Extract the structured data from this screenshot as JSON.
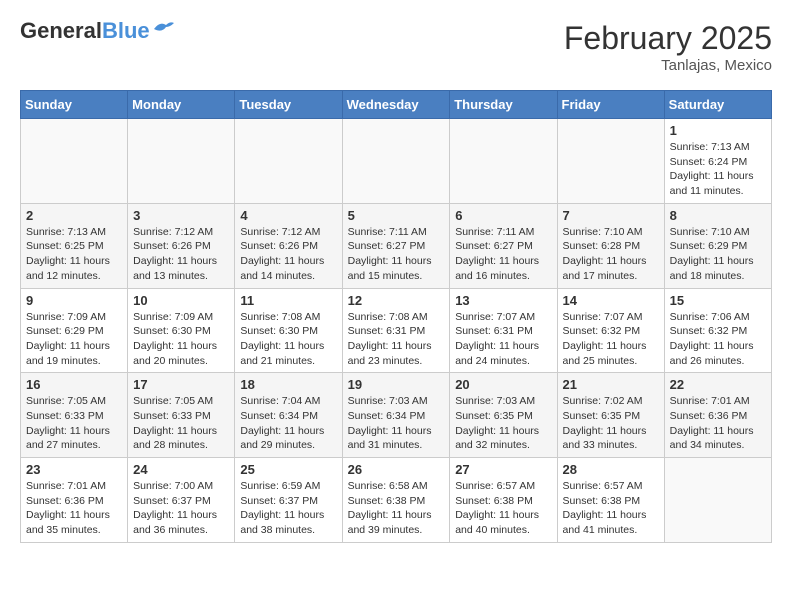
{
  "logo": {
    "general": "General",
    "blue": "Blue"
  },
  "header": {
    "month_year": "February 2025",
    "location": "Tanlajas, Mexico"
  },
  "weekdays": [
    "Sunday",
    "Monday",
    "Tuesday",
    "Wednesday",
    "Thursday",
    "Friday",
    "Saturday"
  ],
  "weeks": [
    [
      {
        "day": "",
        "info": ""
      },
      {
        "day": "",
        "info": ""
      },
      {
        "day": "",
        "info": ""
      },
      {
        "day": "",
        "info": ""
      },
      {
        "day": "",
        "info": ""
      },
      {
        "day": "",
        "info": ""
      },
      {
        "day": "1",
        "info": "Sunrise: 7:13 AM\nSunset: 6:24 PM\nDaylight: 11 hours and 11 minutes."
      }
    ],
    [
      {
        "day": "2",
        "info": "Sunrise: 7:13 AM\nSunset: 6:25 PM\nDaylight: 11 hours and 12 minutes."
      },
      {
        "day": "3",
        "info": "Sunrise: 7:12 AM\nSunset: 6:26 PM\nDaylight: 11 hours and 13 minutes."
      },
      {
        "day": "4",
        "info": "Sunrise: 7:12 AM\nSunset: 6:26 PM\nDaylight: 11 hours and 14 minutes."
      },
      {
        "day": "5",
        "info": "Sunrise: 7:11 AM\nSunset: 6:27 PM\nDaylight: 11 hours and 15 minutes."
      },
      {
        "day": "6",
        "info": "Sunrise: 7:11 AM\nSunset: 6:27 PM\nDaylight: 11 hours and 16 minutes."
      },
      {
        "day": "7",
        "info": "Sunrise: 7:10 AM\nSunset: 6:28 PM\nDaylight: 11 hours and 17 minutes."
      },
      {
        "day": "8",
        "info": "Sunrise: 7:10 AM\nSunset: 6:29 PM\nDaylight: 11 hours and 18 minutes."
      }
    ],
    [
      {
        "day": "9",
        "info": "Sunrise: 7:09 AM\nSunset: 6:29 PM\nDaylight: 11 hours and 19 minutes."
      },
      {
        "day": "10",
        "info": "Sunrise: 7:09 AM\nSunset: 6:30 PM\nDaylight: 11 hours and 20 minutes."
      },
      {
        "day": "11",
        "info": "Sunrise: 7:08 AM\nSunset: 6:30 PM\nDaylight: 11 hours and 21 minutes."
      },
      {
        "day": "12",
        "info": "Sunrise: 7:08 AM\nSunset: 6:31 PM\nDaylight: 11 hours and 23 minutes."
      },
      {
        "day": "13",
        "info": "Sunrise: 7:07 AM\nSunset: 6:31 PM\nDaylight: 11 hours and 24 minutes."
      },
      {
        "day": "14",
        "info": "Sunrise: 7:07 AM\nSunset: 6:32 PM\nDaylight: 11 hours and 25 minutes."
      },
      {
        "day": "15",
        "info": "Sunrise: 7:06 AM\nSunset: 6:32 PM\nDaylight: 11 hours and 26 minutes."
      }
    ],
    [
      {
        "day": "16",
        "info": "Sunrise: 7:05 AM\nSunset: 6:33 PM\nDaylight: 11 hours and 27 minutes."
      },
      {
        "day": "17",
        "info": "Sunrise: 7:05 AM\nSunset: 6:33 PM\nDaylight: 11 hours and 28 minutes."
      },
      {
        "day": "18",
        "info": "Sunrise: 7:04 AM\nSunset: 6:34 PM\nDaylight: 11 hours and 29 minutes."
      },
      {
        "day": "19",
        "info": "Sunrise: 7:03 AM\nSunset: 6:34 PM\nDaylight: 11 hours and 31 minutes."
      },
      {
        "day": "20",
        "info": "Sunrise: 7:03 AM\nSunset: 6:35 PM\nDaylight: 11 hours and 32 minutes."
      },
      {
        "day": "21",
        "info": "Sunrise: 7:02 AM\nSunset: 6:35 PM\nDaylight: 11 hours and 33 minutes."
      },
      {
        "day": "22",
        "info": "Sunrise: 7:01 AM\nSunset: 6:36 PM\nDaylight: 11 hours and 34 minutes."
      }
    ],
    [
      {
        "day": "23",
        "info": "Sunrise: 7:01 AM\nSunset: 6:36 PM\nDaylight: 11 hours and 35 minutes."
      },
      {
        "day": "24",
        "info": "Sunrise: 7:00 AM\nSunset: 6:37 PM\nDaylight: 11 hours and 36 minutes."
      },
      {
        "day": "25",
        "info": "Sunrise: 6:59 AM\nSunset: 6:37 PM\nDaylight: 11 hours and 38 minutes."
      },
      {
        "day": "26",
        "info": "Sunrise: 6:58 AM\nSunset: 6:38 PM\nDaylight: 11 hours and 39 minutes."
      },
      {
        "day": "27",
        "info": "Sunrise: 6:57 AM\nSunset: 6:38 PM\nDaylight: 11 hours and 40 minutes."
      },
      {
        "day": "28",
        "info": "Sunrise: 6:57 AM\nSunset: 6:38 PM\nDaylight: 11 hours and 41 minutes."
      },
      {
        "day": "",
        "info": ""
      }
    ]
  ]
}
